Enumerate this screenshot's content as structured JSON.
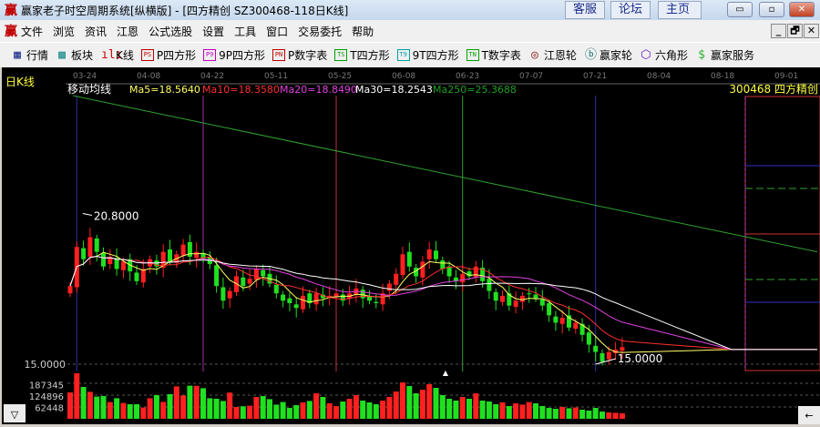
{
  "window": {
    "logo": "赢",
    "title": "赢家老子时空周期系统[纵横版] - [四方精创   SZ300468-118日K线]",
    "links": [
      "客服",
      "论坛",
      "主页"
    ],
    "controls": {
      "minimize": "▭",
      "maximize": "▫",
      "close": "✕"
    }
  },
  "menu": {
    "logo": "赢",
    "items": [
      "文件",
      "浏览",
      "资讯",
      "江恩",
      "公式选股",
      "设置",
      "工具",
      "窗口",
      "交易委托",
      "帮助"
    ],
    "mdi": [
      "_",
      "🗗",
      "✕"
    ]
  },
  "toolbar": [
    {
      "label": "行情",
      "icon": "grid-icon",
      "glyph": "▦",
      "color": "#1a2c8c"
    },
    {
      "label": "板块",
      "icon": "blocks-icon",
      "glyph": "▩",
      "color": "#1a8c8c"
    },
    {
      "label": "K线",
      "icon": "candles-icon",
      "glyph": "ılı",
      "color": "#d00000"
    },
    {
      "label": "P四方形",
      "icon": "ps-icon",
      "glyph": "PS",
      "color": "#c00000"
    },
    {
      "label": "9P四方形",
      "icon": "p9-icon",
      "glyph": "P9",
      "color": "#c000c0"
    },
    {
      "label": "P数字表",
      "icon": "pn-icon",
      "glyph": "PN",
      "color": "#c00000"
    },
    {
      "label": "T四方形",
      "icon": "ts-icon",
      "glyph": "TS",
      "color": "#00a000"
    },
    {
      "label": "9T四方形",
      "icon": "t9-icon",
      "glyph": "T9",
      "color": "#00a0a0"
    },
    {
      "label": "T数字表",
      "icon": "tn-icon",
      "glyph": "TN",
      "color": "#00a000"
    },
    {
      "label": "江恩轮",
      "icon": "gann-wheel-icon",
      "glyph": "◎",
      "color": "#8c1a1a"
    },
    {
      "label": "赢家轮",
      "icon": "big-wheel-icon",
      "glyph": "ⓑ",
      "color": "#1a6c6c"
    },
    {
      "label": "六角形",
      "icon": "hexagon-icon",
      "glyph": "⬡",
      "color": "#6c1ac0"
    },
    {
      "label": "赢家服务",
      "icon": "dollar-icon",
      "glyph": "$",
      "color": "#30b030"
    }
  ],
  "chart_data": {
    "type": "candlestick",
    "period_label": "日K线",
    "indicator_title": "移动均线",
    "ma_labels": [
      {
        "text": "Ma5=18.5640",
        "color": "#ffff66"
      },
      {
        "text": "Ma10=18.3580",
        "color": "#ff3030"
      },
      {
        "text": "Ma20=18.8490",
        "color": "#e040e0"
      },
      {
        "text": "Ma30=18.2543",
        "color": "#ffffff"
      },
      {
        "text": "Ma250=25.3688",
        "color": "#20a020"
      }
    ],
    "stock_label": "300468  四方精创",
    "dates": [
      "03-24",
      "04-08",
      "04-22",
      "05-11",
      "05-25",
      "06-08",
      "06-23",
      "07-07",
      "07-21",
      "08-04",
      "08-18",
      "09-01"
    ],
    "price_min": 15.0,
    "price_max": 26.0,
    "y_label_low": "15.0000",
    "high_label": "20.8000",
    "high_value": 20.8,
    "high_index": 3,
    "low_label": "15.0000",
    "low_value": 15.0,
    "low_index": 79,
    "closes": [
      18.2,
      19.8,
      19.3,
      20.2,
      19.6,
      19.0,
      19.4,
      18.9,
      19.2,
      18.8,
      18.4,
      18.9,
      19.3,
      19.0,
      19.6,
      19.2,
      19.5,
      19.9,
      19.4,
      19.6,
      19.3,
      19.1,
      18.2,
      17.6,
      18.0,
      18.6,
      18.2,
      18.5,
      18.9,
      18.6,
      18.3,
      17.9,
      17.6,
      17.5,
      17.3,
      17.8,
      17.5,
      17.9,
      17.7,
      17.8,
      17.9,
      17.6,
      17.9,
      18.1,
      17.7,
      17.6,
      17.5,
      17.9,
      18.3,
      18.7,
      19.5,
      19.0,
      18.6,
      19.2,
      19.7,
      19.3,
      18.9,
      18.6,
      18.4,
      18.7,
      18.6,
      19.0,
      18.4,
      18.0,
      17.6,
      17.8,
      17.4,
      17.6,
      17.8,
      17.9,
      17.7,
      17.4,
      17.0,
      16.7,
      16.9,
      16.5,
      16.7,
      16.2,
      15.8,
      15.5,
      15.1,
      15.5,
      15.6,
      15.7
    ],
    "ma250_range": [
      26.0,
      19.6
    ],
    "cycle_lines": [
      {
        "index": 1,
        "color": "#3030a0"
      },
      {
        "index": 20,
        "color": "#a030a0"
      },
      {
        "index": 40,
        "color": "#c03040"
      },
      {
        "index": 59,
        "color": "#30a030"
      },
      {
        "index": 79,
        "color": "#3030a0"
      }
    ],
    "volume_ticks": [
      187345,
      124896,
      62448
    ],
    "volume_max": 260000,
    "volumes": [
      145000,
      250000,
      175000,
      148000,
      122000,
      125000,
      92000,
      113000,
      87000,
      80000,
      80000,
      62000,
      113000,
      130000,
      93000,
      135000,
      178000,
      128000,
      182000,
      181000,
      168000,
      113000,
      110000,
      98000,
      144000,
      65000,
      69000,
      72000,
      120000,
      125000,
      108000,
      78000,
      92000,
      60000,
      75000,
      90000,
      98000,
      140000,
      120000,
      85000,
      70000,
      95000,
      110000,
      130000,
      100000,
      90000,
      80000,
      100000,
      120000,
      150000,
      200000,
      180000,
      140000,
      160000,
      190000,
      170000,
      130000,
      110000,
      100000,
      120000,
      110000,
      140000,
      100000,
      95000,
      80000,
      90000,
      70000,
      85000,
      78000,
      92000,
      85000,
      70000,
      60000,
      55000,
      65000,
      58000,
      62000,
      50000,
      45000,
      60000,
      40000,
      35000,
      33000,
      30000
    ],
    "scroll_down": "▽",
    "scroll_left": "←"
  }
}
